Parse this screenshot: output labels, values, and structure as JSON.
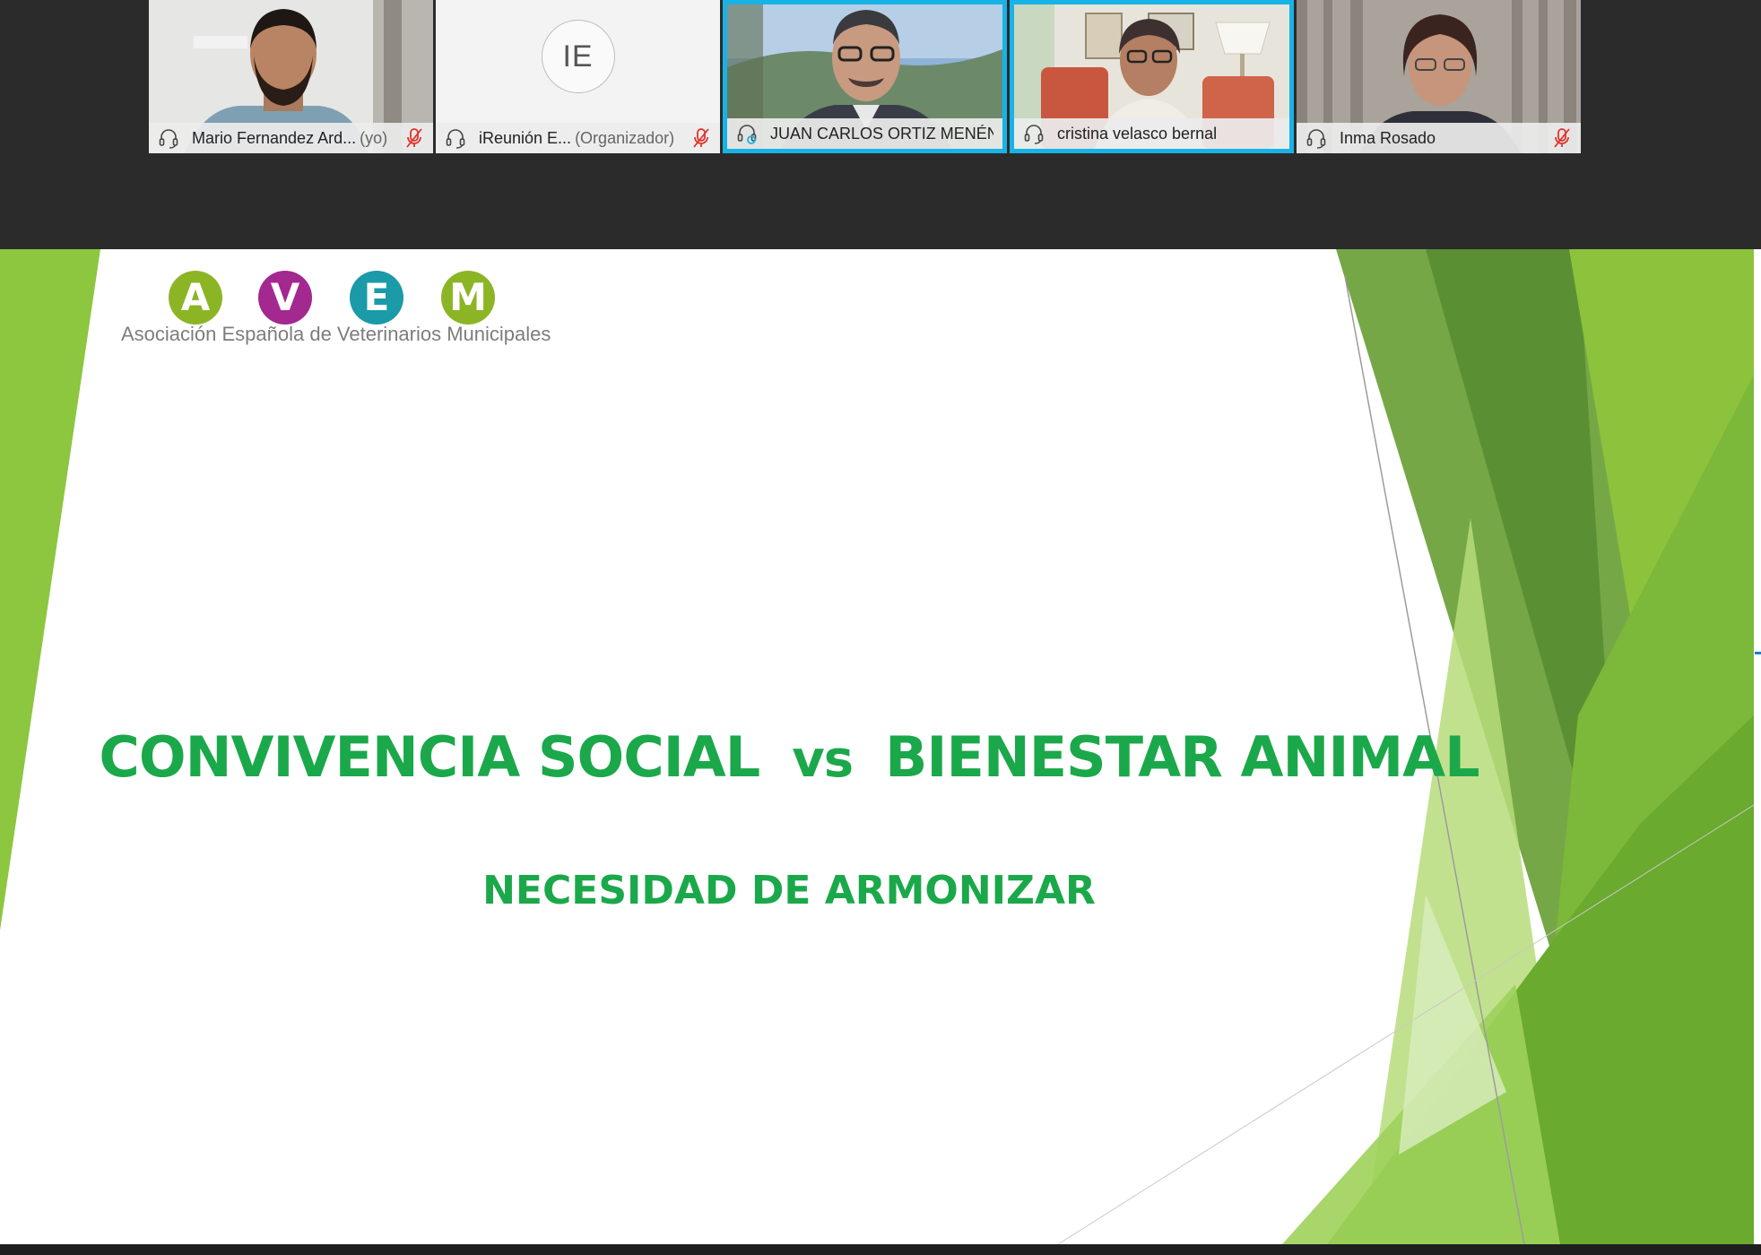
{
  "participants": [
    {
      "name": "Mario Fernandez Ard...",
      "role": "(yo)",
      "muted": true,
      "active": false,
      "avatar": ""
    },
    {
      "name": "iReunión E...",
      "role": "(Organizador)",
      "muted": true,
      "active": false,
      "avatar": "IE"
    },
    {
      "name": "JUAN CARLOS ORTIZ MENÉNDEZ",
      "role": "",
      "muted": false,
      "active": true,
      "avatar": ""
    },
    {
      "name": "cristina velasco bernal",
      "role": "",
      "muted": false,
      "active": true,
      "avatar": ""
    },
    {
      "name": "Inma Rosado",
      "role": "",
      "muted": true,
      "active": false,
      "avatar": ""
    }
  ],
  "slide": {
    "logo_letters": [
      "A",
      "V",
      "E",
      "M"
    ],
    "logo_colors": [
      "#8cb526",
      "#a3288f",
      "#1b9aa8",
      "#8cb526"
    ],
    "organization": "Asociación Española de Veterinarios Municipales",
    "title_left": "CONVIVENCIA SOCIAL",
    "title_vs": "vs",
    "title_right": "BIENESTAR ANIMAL",
    "subtitle": "NECESIDAD DE ARMONIZAR",
    "accent_color": "#1ba84a"
  },
  "icons": {
    "headset": "headset-icon",
    "mute": "microphone-muted-icon"
  }
}
